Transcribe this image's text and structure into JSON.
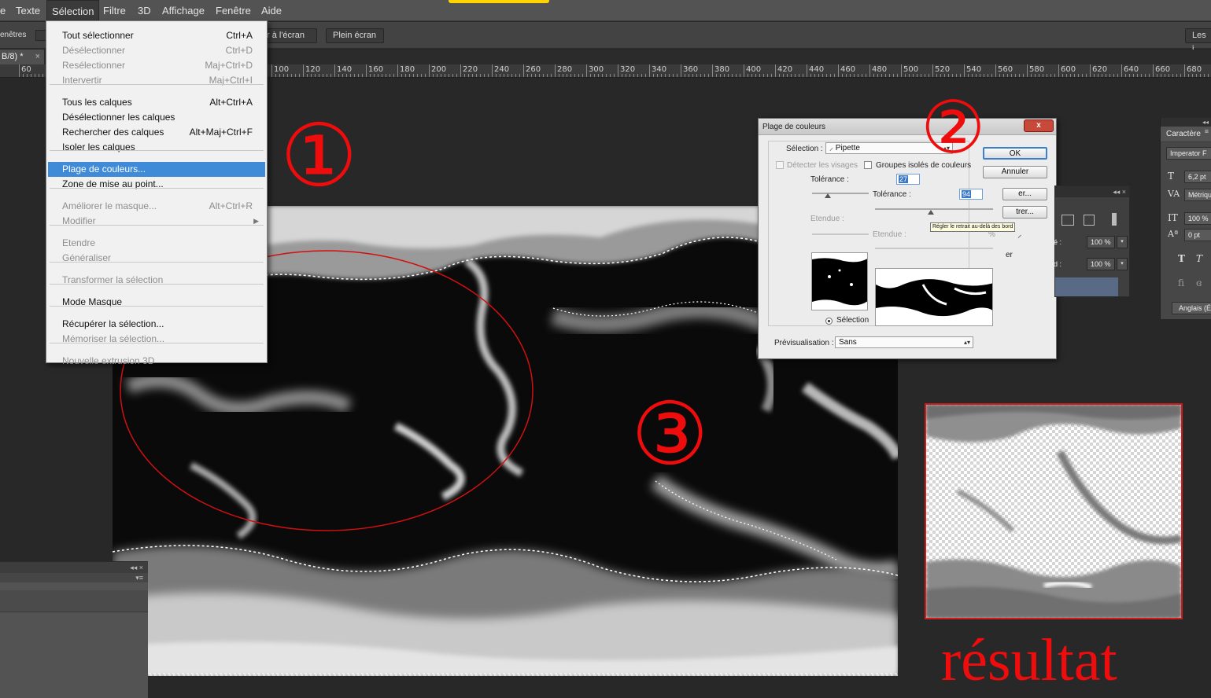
{
  "menubar": {
    "items": [
      "e",
      "Texte",
      "Sélection",
      "Filtre",
      "3D",
      "Affichage",
      "Fenêtre",
      "Aide"
    ]
  },
  "options": {
    "left_label": "enêtres",
    "fit_label": "r à l'écran",
    "full_label": "Plein écran",
    "right_label": "Les i"
  },
  "tab": {
    "title": "B/8) *",
    "close": "×"
  },
  "ruler": {
    "labels": [
      "60",
      "100",
      "120",
      "140",
      "160",
      "180",
      "200",
      "220",
      "240",
      "260",
      "280",
      "300",
      "320",
      "340",
      "360",
      "380",
      "400",
      "420",
      "440",
      "460",
      "480",
      "500",
      "520",
      "540",
      "560",
      "580",
      "600",
      "620",
      "640",
      "660",
      "680"
    ]
  },
  "selection_menu": {
    "items": [
      {
        "label": "Tout sélectionner",
        "shortcut": "Ctrl+A",
        "enabled": true
      },
      {
        "label": "Désélectionner",
        "shortcut": "Ctrl+D",
        "enabled": false
      },
      {
        "label": "Resélectionner",
        "shortcut": "Maj+Ctrl+D",
        "enabled": false
      },
      {
        "label": "Intervertir",
        "shortcut": "Maj+Ctrl+I",
        "enabled": false
      },
      {
        "label": "Tous les calques",
        "shortcut": "Alt+Ctrl+A",
        "enabled": true
      },
      {
        "label": "Désélectionner les calques",
        "shortcut": "",
        "enabled": true
      },
      {
        "label": "Rechercher des calques",
        "shortcut": "Alt+Maj+Ctrl+F",
        "enabled": true
      },
      {
        "label": "Isoler les calques",
        "shortcut": "",
        "enabled": true
      },
      {
        "label": "Plage de couleurs...",
        "shortcut": "",
        "enabled": true,
        "highlighted": true
      },
      {
        "label": "Zone de mise au point...",
        "shortcut": "",
        "enabled": true
      },
      {
        "label": "Améliorer le masque...",
        "shortcut": "Alt+Ctrl+R",
        "enabled": false
      },
      {
        "label": "Modifier",
        "shortcut": "",
        "enabled": false,
        "submenu": true
      },
      {
        "label": "Etendre",
        "shortcut": "",
        "enabled": false
      },
      {
        "label": "Généraliser",
        "shortcut": "",
        "enabled": false
      },
      {
        "label": "Transformer la sélection",
        "shortcut": "",
        "enabled": false
      },
      {
        "label": "Mode Masque",
        "shortcut": "",
        "enabled": true
      },
      {
        "label": "Récupérer la sélection...",
        "shortcut": "",
        "enabled": true
      },
      {
        "label": "Mémoriser la sélection...",
        "shortcut": "",
        "enabled": false
      },
      {
        "label": "Nouvelle extrusion 3D",
        "shortcut": "",
        "enabled": false
      }
    ]
  },
  "dialog": {
    "title": "Plage de couleurs",
    "close": "x",
    "selection_label": "Sélection :",
    "selection_value": "Pipette",
    "detect_faces": "Détecter les visages",
    "groups": "Groupes isolés de couleurs",
    "tolerance_label": "Tolérance :",
    "tolerance_value_1": "27",
    "tolerance_value_2": "94",
    "etendue_label": "Etendue :",
    "etendue_unit": "%",
    "ok": "OK",
    "cancel": "Annuler",
    "load_partial": "er...",
    "save_partial": "trer...",
    "invert_partial": "er",
    "tooltip": "Régler le retrait au-delà des bord",
    "radio_label": "Sélection",
    "preview_label": "Prévisualisation :",
    "preview_value": "Sans"
  },
  "mini_panel": {
    "opacity_label": "é :",
    "opacity_value": "100 %",
    "fill_label": "d :",
    "fill_value": "100 %"
  },
  "char_panel": {
    "tab": "Caractère",
    "font": "Imperator F",
    "size": "6,2 pt",
    "kerning": "Métriqu",
    "scale": "100 %",
    "baseline": "0 pt",
    "language": "Anglais (É"
  },
  "annotations": {
    "one": "①",
    "two": "②",
    "three": "③",
    "result": "résultat"
  },
  "colors": {
    "annotation": "#ee0c0c",
    "highlight": "#3f8bd8",
    "yellow": "#ffd400"
  }
}
